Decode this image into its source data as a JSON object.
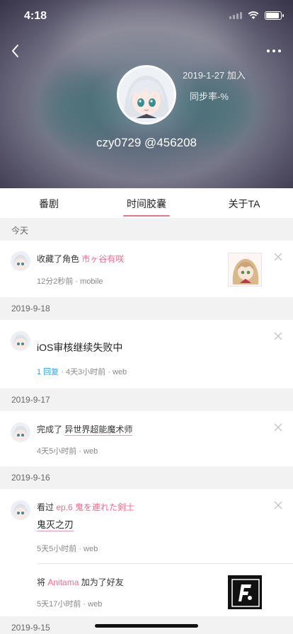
{
  "status_bar": {
    "time": "4:18"
  },
  "profile": {
    "join_date": "2019-1-27 加入",
    "sync_rate": "同步率-%",
    "username": "czy0729 @456208"
  },
  "tabs": [
    {
      "label": "番剧",
      "active": false
    },
    {
      "label": "时间胶囊",
      "active": true
    },
    {
      "label": "关于TA",
      "active": false
    }
  ],
  "feed": {
    "sections": [
      {
        "date": "今天",
        "items": [
          {
            "action": "收藏了角色",
            "target": "市ヶ谷有咲",
            "time": "12分2秒前",
            "source": "mobile"
          }
        ]
      },
      {
        "date": "2019-9-18",
        "items": [
          {
            "text": "iOS审核继续失败中",
            "replies": "1 回复",
            "time": "4天3小时前",
            "source": "web"
          }
        ]
      },
      {
        "date": "2019-9-17",
        "items": [
          {
            "action": "完成了",
            "subject": "异世界超能魔术师",
            "time": "4天5小时前",
            "source": "web"
          }
        ]
      },
      {
        "date": "2019-9-16",
        "items": [
          {
            "action": "看过",
            "target": "ep.6 鬼を連れた剣士",
            "subject": "鬼灭之刃",
            "time": "5天5小时前",
            "source": "web"
          },
          {
            "prefix": "将",
            "target": "Anitama",
            "suffix": "加为了好友",
            "time": "5天17小时前",
            "source": "web"
          }
        ]
      },
      {
        "date": "2019-9-15",
        "items": []
      }
    ]
  },
  "separator": " · ",
  "colors": {
    "accent_pink": "#f06c8c",
    "reply_blue": "#2ba4e6",
    "section_bg": "#f2f2f2"
  }
}
